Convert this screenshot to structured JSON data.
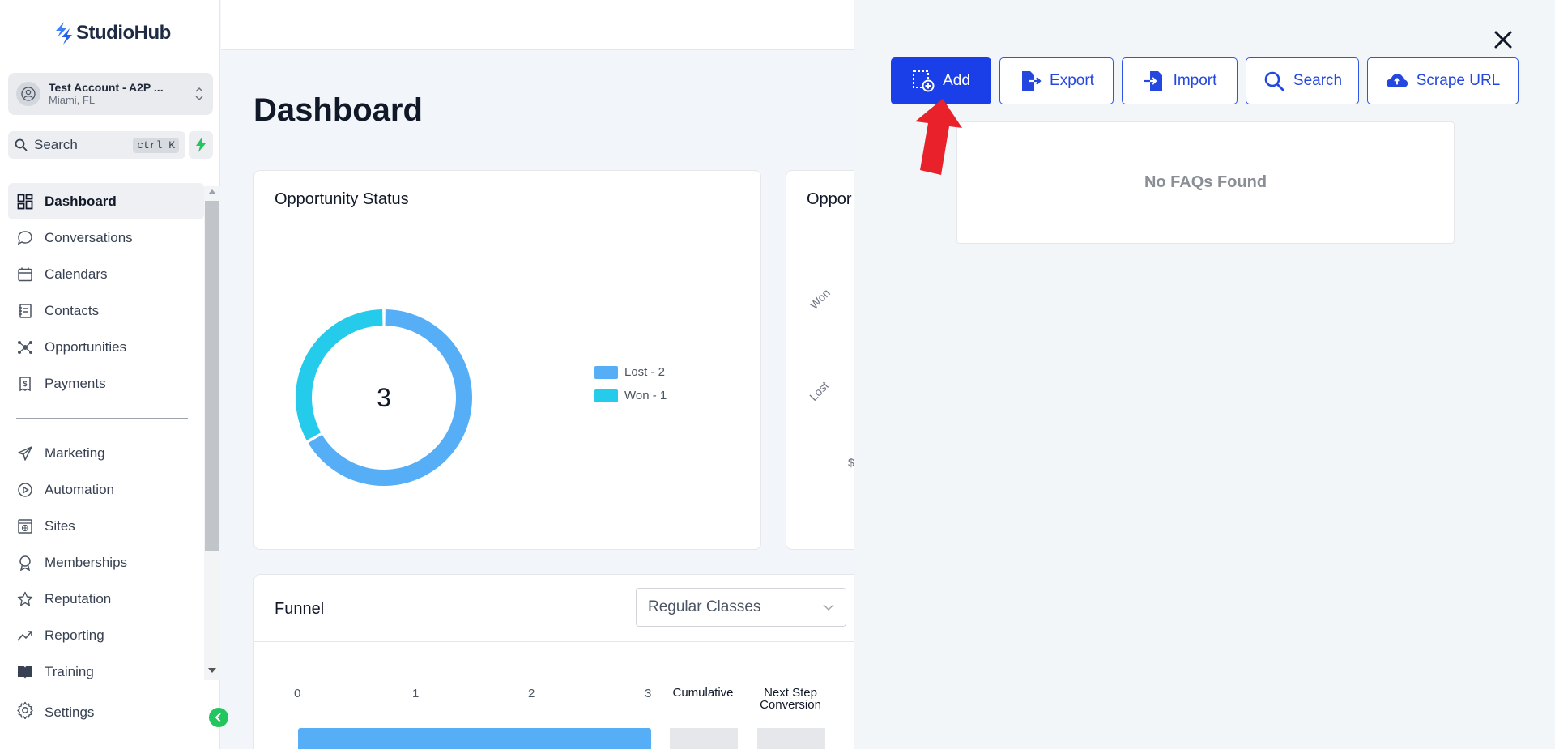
{
  "app": {
    "name": "StudioHub"
  },
  "account": {
    "name": "Test Account - A2P ...",
    "location": "Miami, FL"
  },
  "search": {
    "label": "Search",
    "shortcut": "ctrl K"
  },
  "nav": {
    "items": [
      {
        "label": "Dashboard",
        "icon": "dashboard-grid-icon",
        "active": true
      },
      {
        "label": "Conversations",
        "icon": "chat-bubble-icon"
      },
      {
        "label": "Calendars",
        "icon": "calendar-icon"
      },
      {
        "label": "Contacts",
        "icon": "contacts-book-icon"
      },
      {
        "label": "Opportunities",
        "icon": "opportunities-icon"
      },
      {
        "label": "Payments",
        "icon": "receipt-dollar-icon"
      }
    ],
    "items2": [
      {
        "label": "Marketing",
        "icon": "paper-plane-icon"
      },
      {
        "label": "Automation",
        "icon": "play-circle-icon"
      },
      {
        "label": "Sites",
        "icon": "globe-window-icon"
      },
      {
        "label": "Memberships",
        "icon": "award-icon"
      },
      {
        "label": "Reputation",
        "icon": "star-icon"
      },
      {
        "label": "Reporting",
        "icon": "trend-line-icon"
      },
      {
        "label": "Training",
        "icon": "book-icon"
      }
    ],
    "settings": "Settings"
  },
  "main": {
    "title": "Dashboard",
    "opportunity_status": {
      "title": "Opportunity Status",
      "total": "3",
      "legend": [
        {
          "label": "Lost - 2",
          "color": "#56aef7"
        },
        {
          "label": "Won - 1",
          "color": "#24cbea"
        }
      ]
    },
    "opportunity_value": {
      "title": "Oppor",
      "labels": [
        "Won",
        "Lost"
      ],
      "axis_fragment": "$"
    },
    "funnel": {
      "title": "Funnel",
      "dropdown_value": "Regular Classes",
      "ticks": [
        "0",
        "1",
        "2",
        "3"
      ],
      "col_cumulative": "Cumulative",
      "col_next_step": "Next Step Conversion"
    }
  },
  "chart_data": {
    "type": "pie",
    "title": "Opportunity Status",
    "categories": [
      "Lost",
      "Won"
    ],
    "values": [
      2,
      1
    ],
    "colors": [
      "#56aef7",
      "#24cbea"
    ],
    "center_label": "3",
    "legend_position": "right"
  },
  "panel": {
    "buttons": [
      {
        "label": "Add",
        "icon": "add-box-icon",
        "primary": true
      },
      {
        "label": "Export",
        "icon": "export-file-icon"
      },
      {
        "label": "Import",
        "icon": "import-file-icon"
      },
      {
        "label": "Search",
        "icon": "search-icon"
      },
      {
        "label": "Scrape URL",
        "icon": "cloud-upload-icon"
      }
    ],
    "empty_message": "No FAQs Found"
  },
  "colors": {
    "accent": "#1a3fe8",
    "annotation_arrow": "#e8212b",
    "toggle_green": "#22c55e"
  }
}
